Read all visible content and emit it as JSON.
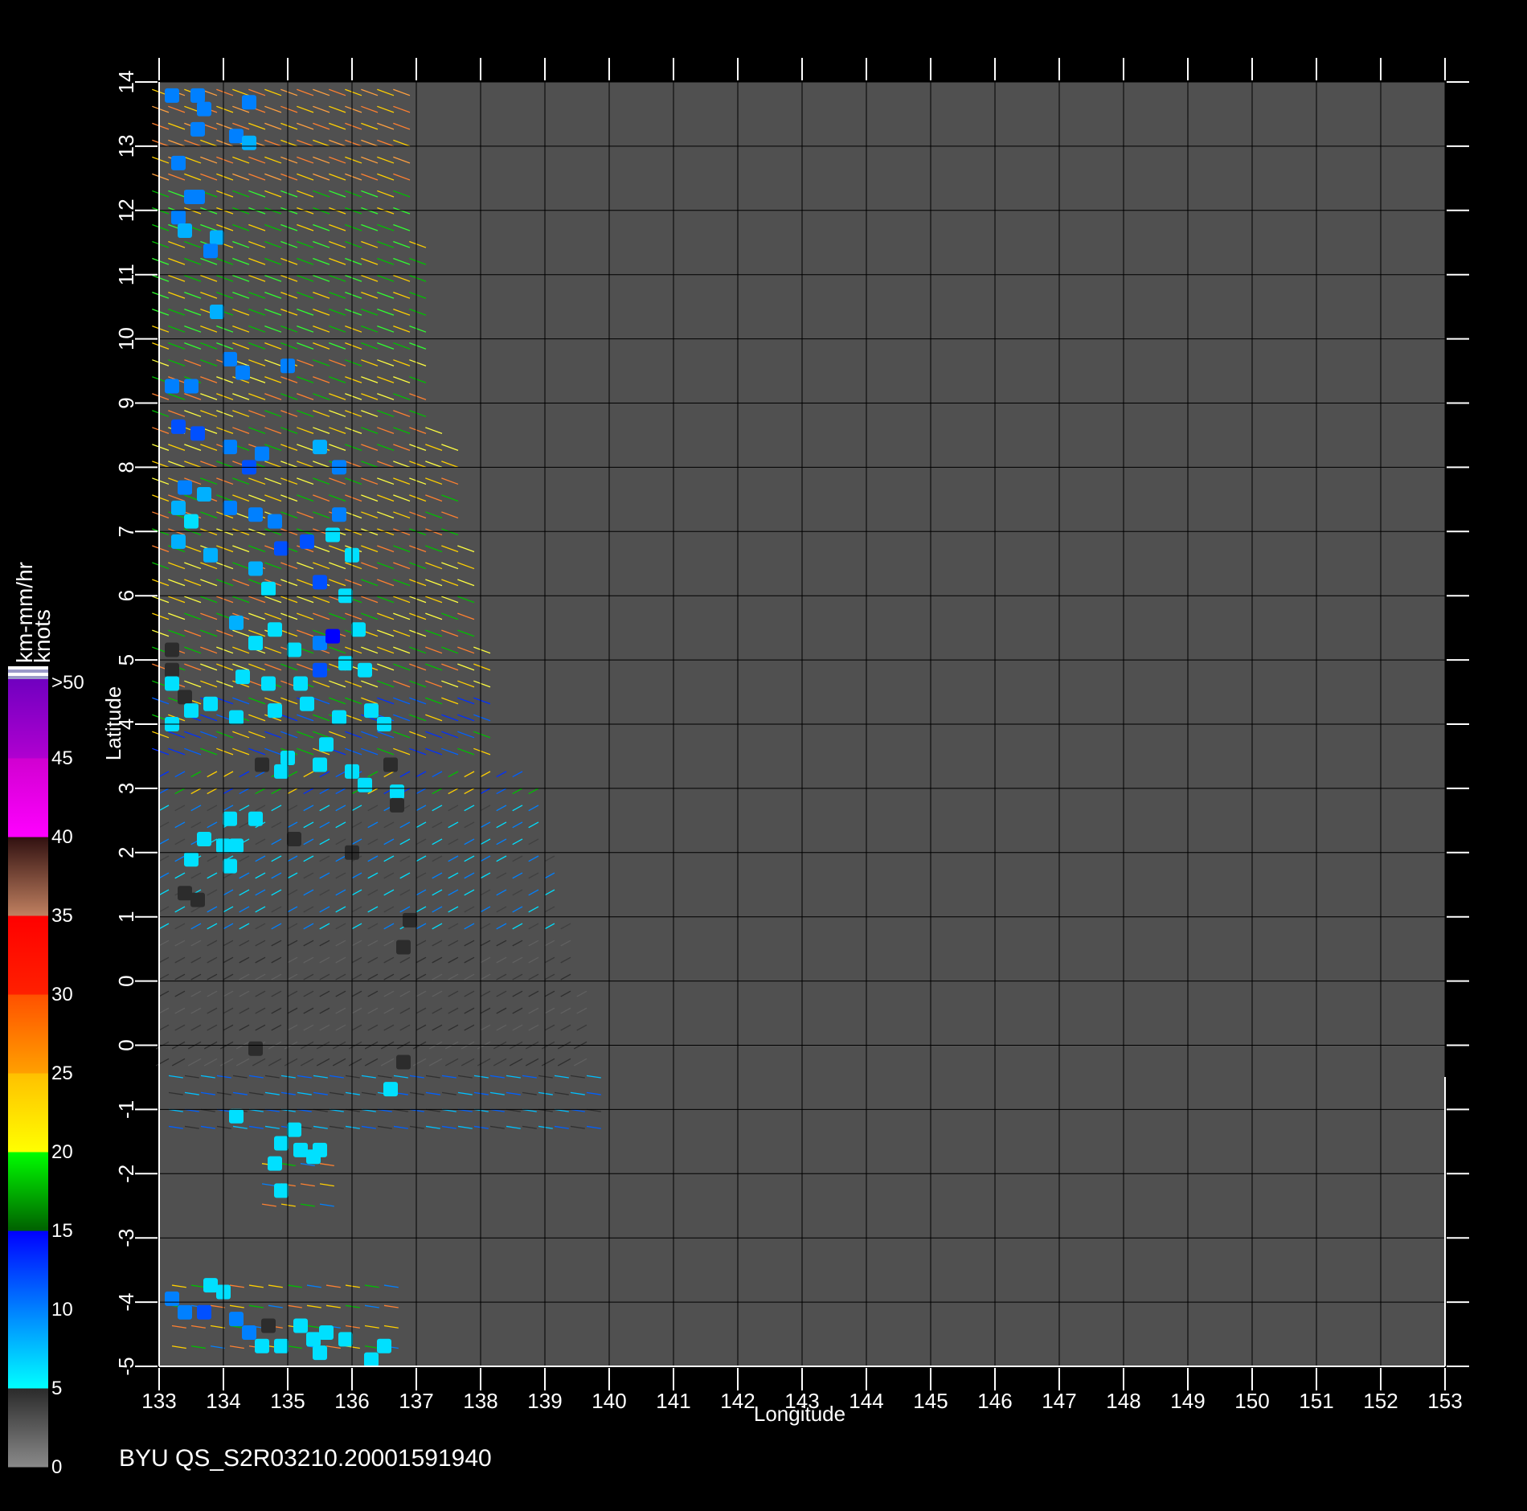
{
  "footer": {
    "caption": "BYU  QS_S2R03210.20001591940"
  },
  "colors": {
    "background": "#000000",
    "plot_area": "#505050",
    "grid": "#000000",
    "axis": "#ffffff"
  },
  "chart_data": {
    "type": "scatter",
    "xlabel": "Longitude",
    "ylabel": "Latitude",
    "xlim": [
      133,
      153
    ],
    "ylim": [
      -5,
      14
    ],
    "x_ticks": [
      "133",
      "134",
      "135",
      "136",
      "137",
      "138",
      "139",
      "140",
      "141",
      "142",
      "143",
      "144",
      "145",
      "146",
      "147",
      "148",
      "149",
      "150",
      "151",
      "152",
      "153"
    ],
    "y_ticks": [
      "14",
      "13",
      "12",
      "11",
      "10",
      "9",
      "8",
      "7",
      "6",
      "5",
      "4",
      "3",
      "2",
      "1",
      "0",
      "0",
      "-1",
      "-2",
      "-3",
      "-4",
      "-5"
    ],
    "grid": true,
    "colorbar": {
      "units": [
        "km-mm/hr",
        "knots"
      ],
      "labels": [
        ">50",
        "45",
        "40",
        "35",
        "30",
        "25",
        "20",
        "15",
        "10",
        "5",
        "0"
      ],
      "segments": [
        {
          "range": "0-5",
          "colors": [
            "#8a8a8a",
            "#2a2a2a"
          ]
        },
        {
          "range": "5-10",
          "colors": [
            "#00ffff",
            "#0080ff"
          ]
        },
        {
          "range": "10-15",
          "colors": [
            "#0080ff",
            "#0000ff"
          ]
        },
        {
          "range": "15-20",
          "colors": [
            "#006000",
            "#00ff00"
          ]
        },
        {
          "range": "20-25",
          "colors": [
            "#ffff00",
            "#ffc000"
          ]
        },
        {
          "range": "25-30",
          "colors": [
            "#ffa000",
            "#ff5000"
          ]
        },
        {
          "range": "30-35",
          "colors": [
            "#ff2000",
            "#ff0000"
          ]
        },
        {
          "range": "35-40",
          "colors": [
            "#c08060",
            "#301010"
          ]
        },
        {
          "range": "40-45",
          "colors": [
            "#ff00ff",
            "#d000d0"
          ]
        },
        {
          "range": "45-50",
          "colors": [
            "#b000d0",
            "#7000c0"
          ]
        }
      ]
    },
    "rain_cells": [
      {
        "lon": 133.2,
        "lat": 13.8,
        "v": 10
      },
      {
        "lon": 133.6,
        "lat": 13.8,
        "v": 10
      },
      {
        "lon": 133.7,
        "lat": 13.6,
        "v": 10
      },
      {
        "lon": 134.4,
        "lat": 13.7,
        "v": 10
      },
      {
        "lon": 133.6,
        "lat": 13.3,
        "v": 10
      },
      {
        "lon": 134.2,
        "lat": 13.2,
        "v": 10
      },
      {
        "lon": 134.4,
        "lat": 13.1,
        "v": 8
      },
      {
        "lon": 133.3,
        "lat": 12.8,
        "v": 10
      },
      {
        "lon": 133.5,
        "lat": 12.3,
        "v": 10
      },
      {
        "lon": 133.6,
        "lat": 12.3,
        "v": 10
      },
      {
        "lon": 133.3,
        "lat": 12.0,
        "v": 10
      },
      {
        "lon": 133.4,
        "lat": 11.8,
        "v": 8
      },
      {
        "lon": 133.9,
        "lat": 11.7,
        "v": 8
      },
      {
        "lon": 133.8,
        "lat": 11.5,
        "v": 10
      },
      {
        "lon": 133.9,
        "lat": 10.6,
        "v": 8
      },
      {
        "lon": 134.1,
        "lat": 9.9,
        "v": 10
      },
      {
        "lon": 134.3,
        "lat": 9.7,
        "v": 10
      },
      {
        "lon": 135.0,
        "lat": 9.8,
        "v": 10
      },
      {
        "lon": 133.2,
        "lat": 9.5,
        "v": 10
      },
      {
        "lon": 133.5,
        "lat": 9.5,
        "v": 10
      },
      {
        "lon": 133.3,
        "lat": 8.9,
        "v": 12
      },
      {
        "lon": 133.6,
        "lat": 8.8,
        "v": 12
      },
      {
        "lon": 134.1,
        "lat": 8.6,
        "v": 10
      },
      {
        "lon": 134.6,
        "lat": 8.5,
        "v": 10
      },
      {
        "lon": 134.4,
        "lat": 8.3,
        "v": 12
      },
      {
        "lon": 135.5,
        "lat": 8.6,
        "v": 8
      },
      {
        "lon": 135.8,
        "lat": 8.3,
        "v": 10
      },
      {
        "lon": 133.4,
        "lat": 8.0,
        "v": 10
      },
      {
        "lon": 133.7,
        "lat": 7.9,
        "v": 8
      },
      {
        "lon": 133.3,
        "lat": 7.7,
        "v": 8
      },
      {
        "lon": 133.5,
        "lat": 7.5,
        "v": 6
      },
      {
        "lon": 133.3,
        "lat": 7.2,
        "v": 8
      },
      {
        "lon": 133.8,
        "lat": 7.0,
        "v": 8
      },
      {
        "lon": 134.1,
        "lat": 7.7,
        "v": 10
      },
      {
        "lon": 134.5,
        "lat": 7.6,
        "v": 10
      },
      {
        "lon": 134.8,
        "lat": 7.5,
        "v": 10
      },
      {
        "lon": 134.9,
        "lat": 7.1,
        "v": 12
      },
      {
        "lon": 135.3,
        "lat": 7.2,
        "v": 12
      },
      {
        "lon": 135.7,
        "lat": 7.3,
        "v": 6
      },
      {
        "lon": 135.8,
        "lat": 7.6,
        "v": 10
      },
      {
        "lon": 136.0,
        "lat": 7.0,
        "v": 6
      },
      {
        "lon": 134.5,
        "lat": 6.8,
        "v": 8
      },
      {
        "lon": 134.7,
        "lat": 6.5,
        "v": 6
      },
      {
        "lon": 135.5,
        "lat": 6.6,
        "v": 12
      },
      {
        "lon": 135.9,
        "lat": 6.4,
        "v": 6
      },
      {
        "lon": 134.2,
        "lat": 6.0,
        "v": 8
      },
      {
        "lon": 134.5,
        "lat": 5.7,
        "v": 6
      },
      {
        "lon": 134.8,
        "lat": 5.9,
        "v": 6
      },
      {
        "lon": 135.1,
        "lat": 5.6,
        "v": 6
      },
      {
        "lon": 135.5,
        "lat": 5.7,
        "v": 10
      },
      {
        "lon": 135.7,
        "lat": 5.8,
        "v": 14
      },
      {
        "lon": 136.1,
        "lat": 5.9,
        "v": 6
      },
      {
        "lon": 135.9,
        "lat": 5.4,
        "v": 6
      },
      {
        "lon": 136.2,
        "lat": 5.3,
        "v": 6
      },
      {
        "lon": 134.3,
        "lat": 5.2,
        "v": 6
      },
      {
        "lon": 134.7,
        "lat": 5.1,
        "v": 6
      },
      {
        "lon": 135.2,
        "lat": 5.1,
        "v": 6
      },
      {
        "lon": 135.5,
        "lat": 5.3,
        "v": 12
      },
      {
        "lon": 133.2,
        "lat": 5.6,
        "v": 3
      },
      {
        "lon": 133.2,
        "lat": 5.3,
        "v": 3
      },
      {
        "lon": 133.2,
        "lat": 5.1,
        "v": 6
      },
      {
        "lon": 133.4,
        "lat": 4.9,
        "v": 3
      },
      {
        "lon": 133.5,
        "lat": 4.7,
        "v": 6
      },
      {
        "lon": 133.8,
        "lat": 4.8,
        "v": 6
      },
      {
        "lon": 133.2,
        "lat": 4.5,
        "v": 6
      },
      {
        "lon": 134.2,
        "lat": 4.6,
        "v": 6
      },
      {
        "lon": 134.8,
        "lat": 4.7,
        "v": 6
      },
      {
        "lon": 135.3,
        "lat": 4.8,
        "v": 6
      },
      {
        "lon": 135.8,
        "lat": 4.6,
        "v": 6
      },
      {
        "lon": 136.3,
        "lat": 4.7,
        "v": 6
      },
      {
        "lon": 136.5,
        "lat": 4.5,
        "v": 6
      },
      {
        "lon": 135.6,
        "lat": 4.2,
        "v": 6
      },
      {
        "lon": 135.0,
        "lat": 4.0,
        "v": 6
      },
      {
        "lon": 134.6,
        "lat": 3.9,
        "v": 3
      },
      {
        "lon": 134.9,
        "lat": 3.8,
        "v": 6
      },
      {
        "lon": 135.5,
        "lat": 3.9,
        "v": 6
      },
      {
        "lon": 136.0,
        "lat": 3.8,
        "v": 6
      },
      {
        "lon": 136.2,
        "lat": 3.6,
        "v": 6
      },
      {
        "lon": 136.6,
        "lat": 3.9,
        "v": 3
      },
      {
        "lon": 136.7,
        "lat": 3.5,
        "v": 6
      },
      {
        "lon": 136.7,
        "lat": 3.3,
        "v": 3
      },
      {
        "lon": 134.1,
        "lat": 3.1,
        "v": 6
      },
      {
        "lon": 134.5,
        "lat": 3.1,
        "v": 6
      },
      {
        "lon": 133.7,
        "lat": 2.8,
        "v": 6
      },
      {
        "lon": 134.0,
        "lat": 2.7,
        "v": 6
      },
      {
        "lon": 134.2,
        "lat": 2.7,
        "v": 6
      },
      {
        "lon": 133.5,
        "lat": 2.5,
        "v": 6
      },
      {
        "lon": 134.1,
        "lat": 2.4,
        "v": 6
      },
      {
        "lon": 133.4,
        "lat": 2.0,
        "v": 3
      },
      {
        "lon": 133.6,
        "lat": 1.9,
        "v": 2
      },
      {
        "lon": 135.1,
        "lat": 2.8,
        "v": 2
      },
      {
        "lon": 136.0,
        "lat": 2.6,
        "v": 3
      },
      {
        "lon": 136.9,
        "lat": 1.6,
        "v": 2
      },
      {
        "lon": 136.8,
        "lat": 1.2,
        "v": 2
      },
      {
        "lon": 134.5,
        "lat": -0.3,
        "v": 2
      },
      {
        "lon": 136.8,
        "lat": -0.5,
        "v": 2
      },
      {
        "lon": 136.6,
        "lat": -0.9,
        "v": 6
      },
      {
        "lon": 134.2,
        "lat": -1.3,
        "v": 6
      },
      {
        "lon": 135.1,
        "lat": -1.5,
        "v": 6
      },
      {
        "lon": 134.9,
        "lat": -1.7,
        "v": 6
      },
      {
        "lon": 135.2,
        "lat": -1.8,
        "v": 6
      },
      {
        "lon": 135.4,
        "lat": -1.9,
        "v": 6
      },
      {
        "lon": 135.5,
        "lat": -1.8,
        "v": 6
      },
      {
        "lon": 134.8,
        "lat": -2.0,
        "v": 6
      },
      {
        "lon": 134.9,
        "lat": -2.4,
        "v": 6
      },
      {
        "lon": 133.2,
        "lat": -4.0,
        "v": 10
      },
      {
        "lon": 133.4,
        "lat": -4.2,
        "v": 10
      },
      {
        "lon": 133.7,
        "lat": -4.2,
        "v": 12
      },
      {
        "lon": 133.8,
        "lat": -3.8,
        "v": 6
      },
      {
        "lon": 134.0,
        "lat": -3.9,
        "v": 6
      },
      {
        "lon": 134.2,
        "lat": -4.3,
        "v": 10
      },
      {
        "lon": 134.4,
        "lat": -4.5,
        "v": 10
      },
      {
        "lon": 134.7,
        "lat": -4.4,
        "v": 3
      },
      {
        "lon": 134.6,
        "lat": -4.7,
        "v": 6
      },
      {
        "lon": 134.9,
        "lat": -4.7,
        "v": 6
      },
      {
        "lon": 135.2,
        "lat": -4.4,
        "v": 6
      },
      {
        "lon": 135.4,
        "lat": -4.6,
        "v": 6
      },
      {
        "lon": 135.6,
        "lat": -4.5,
        "v": 6
      },
      {
        "lon": 135.9,
        "lat": -4.6,
        "v": 6
      },
      {
        "lon": 135.5,
        "lat": -4.8,
        "v": 6
      },
      {
        "lon": 136.3,
        "lat": -4.9,
        "v": 6
      },
      {
        "lon": 136.5,
        "lat": -4.7,
        "v": 6
      }
    ]
  }
}
